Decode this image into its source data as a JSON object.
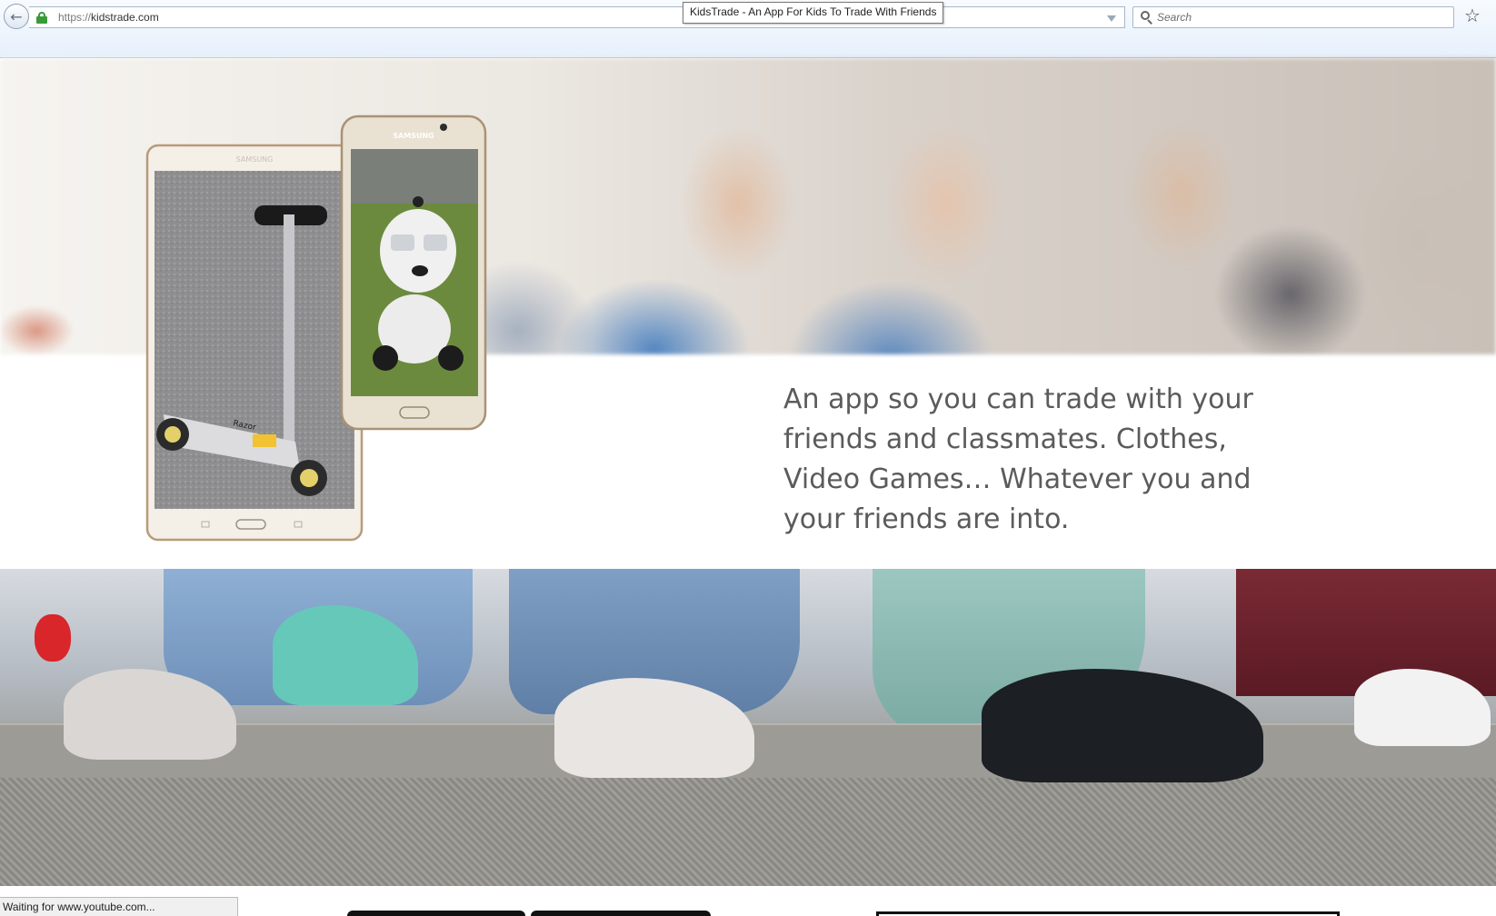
{
  "browser": {
    "url_scheme": "https://",
    "url_host": "kidstrade.com",
    "tab_tooltip": "KidsTrade - An App For Kids To Trade With Friends",
    "search_placeholder": "Search",
    "status_text": "Waiting for www.youtube.com...",
    "icons": {
      "back": "back-arrow-icon",
      "lock": "lock-icon",
      "dropdown": "dropdown-icon",
      "stop": "stop-icon",
      "search": "search-icon",
      "bookmark": "star-icon"
    }
  },
  "page": {
    "tagline": "An app so you can trade with your friends and classmates. Clothes, Video Games… Whatever you and your friends are into.",
    "tablet_brand": "SAMSUNG",
    "phone_brand": "SAMSUNG",
    "scooter_brand": "Razor",
    "colors": {
      "tagline": "#5b5b5b",
      "lock": "#3a9a3a",
      "page_bg": "#ffffff"
    }
  }
}
